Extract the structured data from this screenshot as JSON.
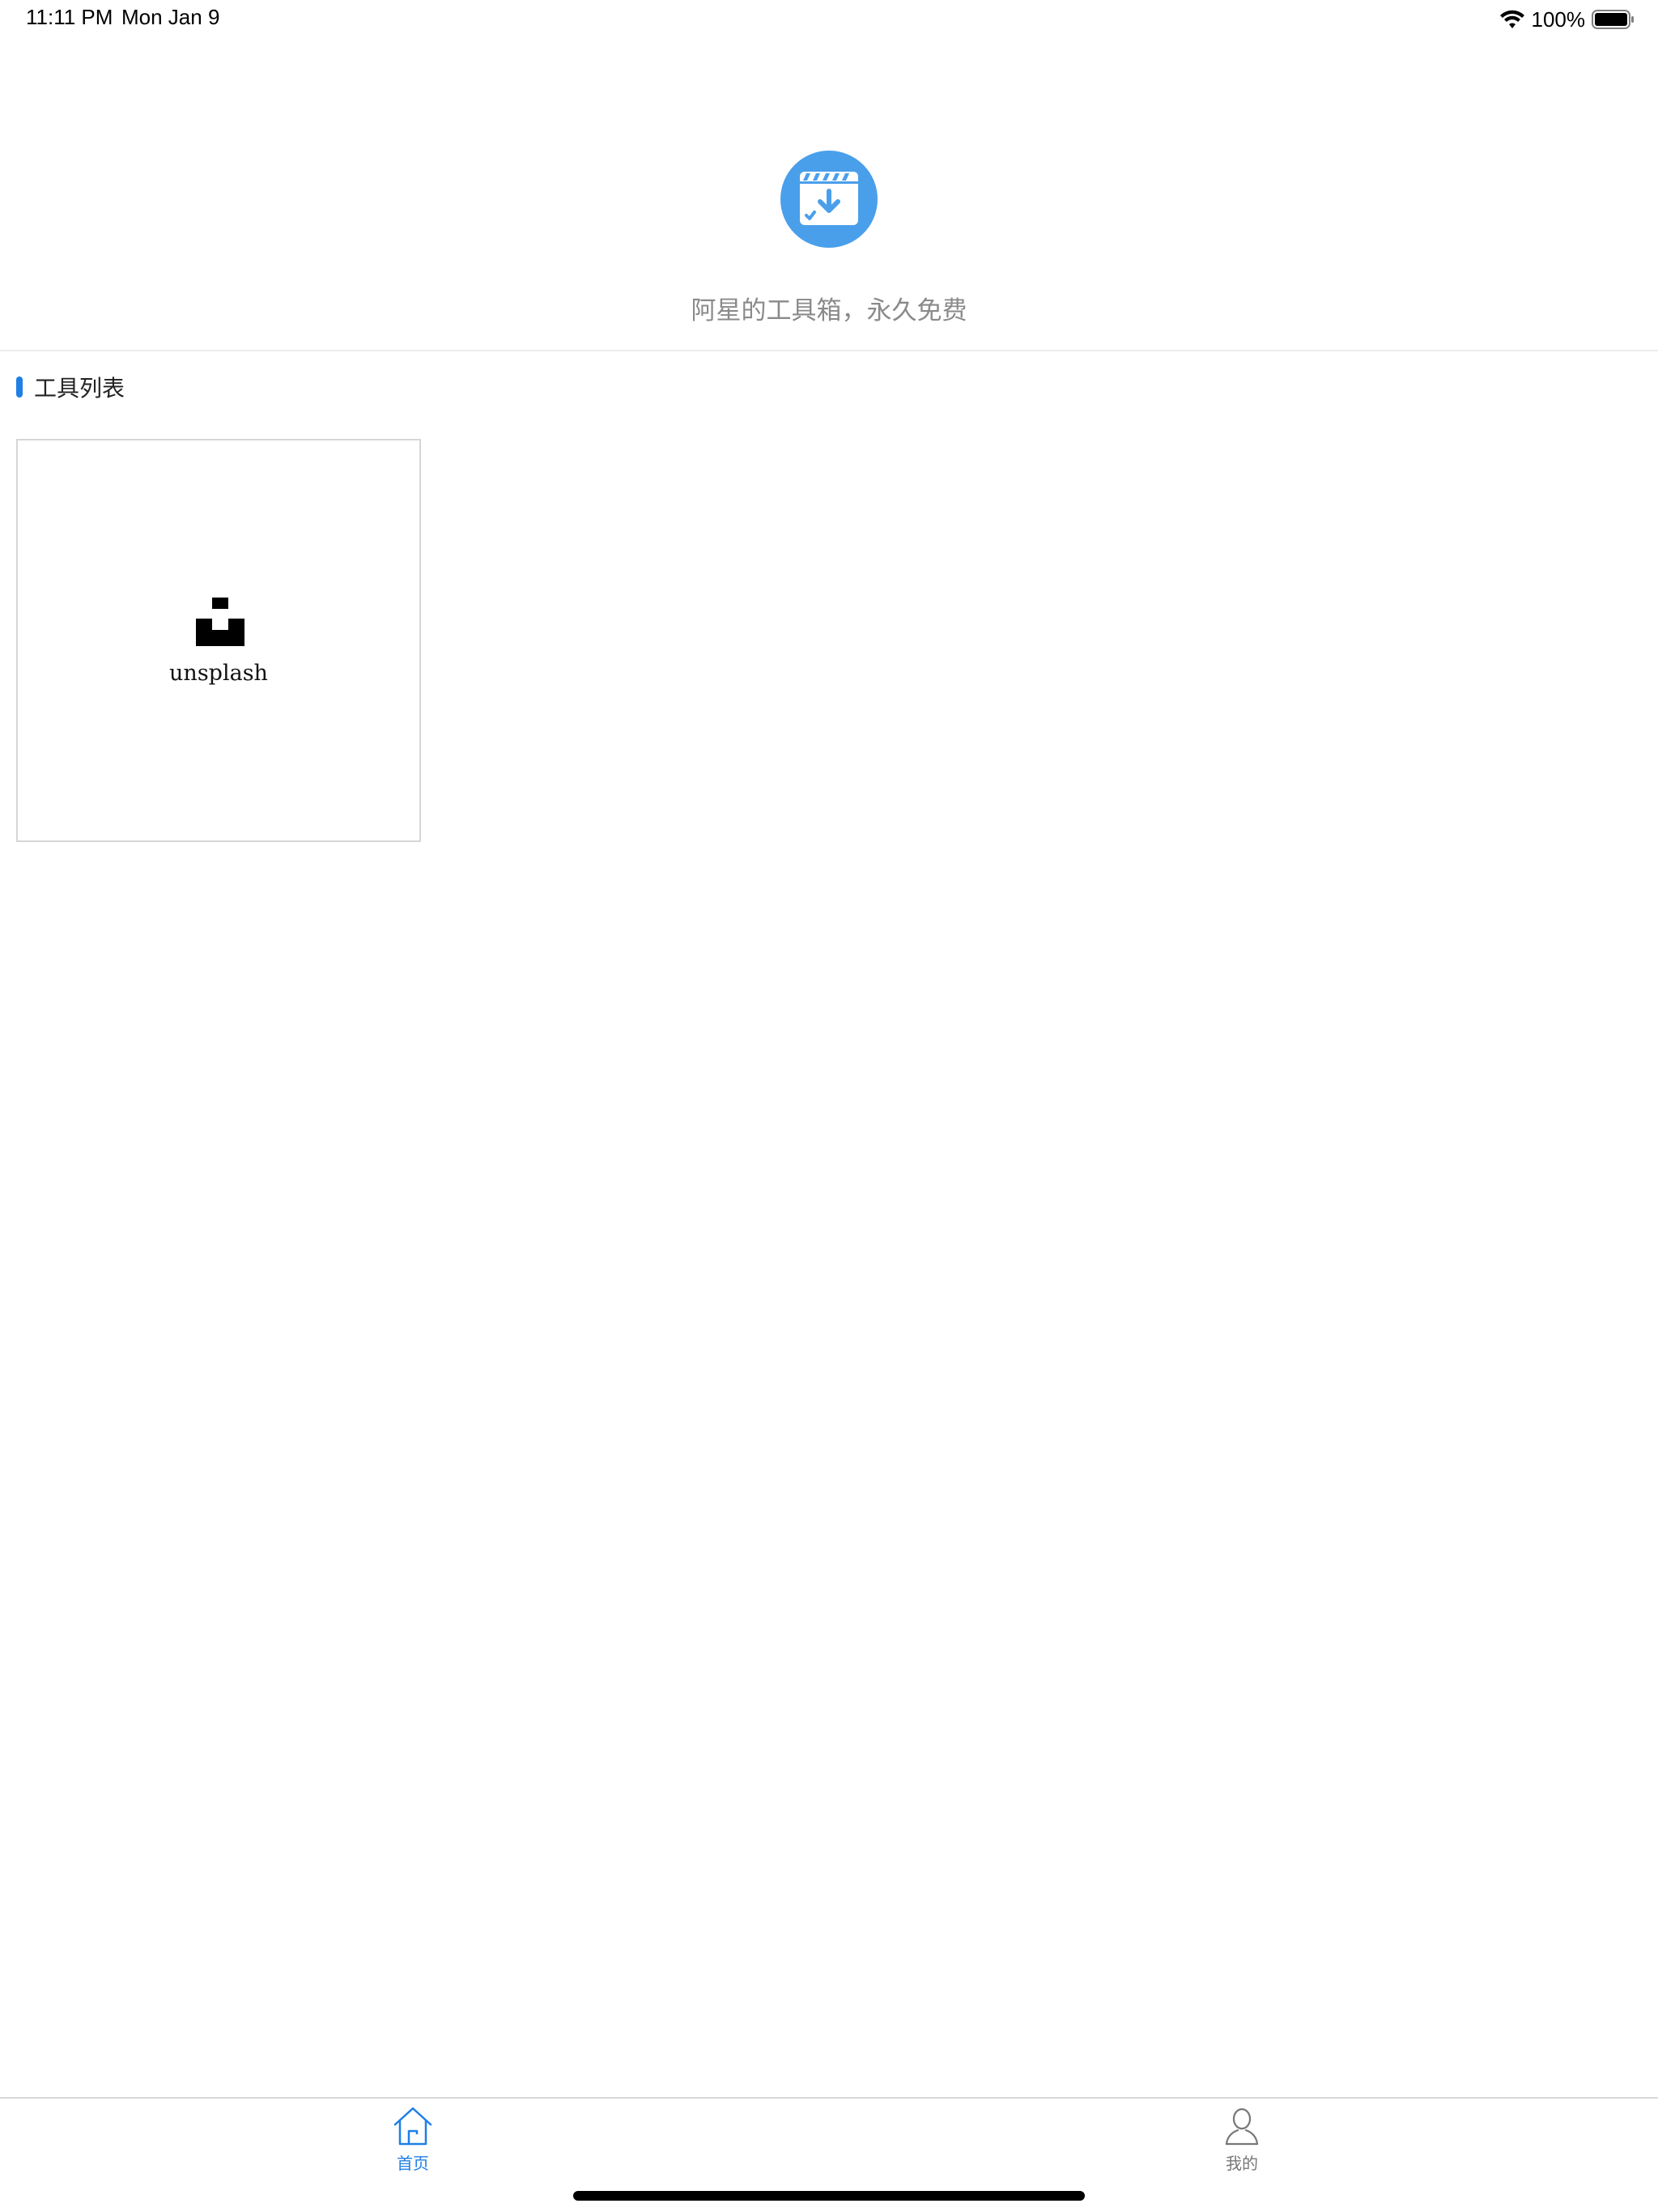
{
  "status_bar": {
    "time": "11:11 PM",
    "date": "Mon Jan 9",
    "battery": "100%",
    "icons": [
      "wifi-icon",
      "battery-icon"
    ]
  },
  "header": {
    "logo_icon": "video-download-icon",
    "slogan": "阿星的工具箱，永久免费",
    "accent_color": "#4a9fea"
  },
  "tools_section": {
    "title": "工具列表",
    "accent_color": "#1f7fe5",
    "items": [
      {
        "label": "unsplash",
        "icon": "unsplash-icon"
      }
    ]
  },
  "tab_bar": {
    "active_color": "#1f7fe5",
    "inactive_color": "#777777",
    "tabs": [
      {
        "label": "首页",
        "icon": "home-icon",
        "active": true
      },
      {
        "label": "我的",
        "icon": "user-icon",
        "active": false
      }
    ]
  }
}
